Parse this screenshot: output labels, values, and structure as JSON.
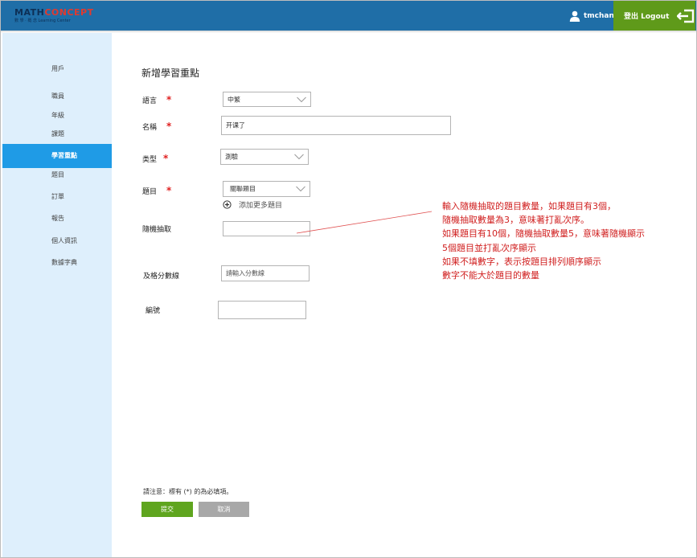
{
  "header": {
    "logo_line1_a": "MATH",
    "logo_line1_b": "CONCEPT",
    "logo_line2": "數 學 · 概 念  Learning Center",
    "username": "tmchan",
    "logout_label": "登出 Logout"
  },
  "sidebar": {
    "items": [
      {
        "label": "用戶"
      },
      {
        "label": "職員"
      },
      {
        "label": "年級"
      },
      {
        "label": "課題"
      },
      {
        "label": "學習重點"
      },
      {
        "label": "題目"
      },
      {
        "label": "訂單"
      },
      {
        "label": "報告"
      },
      {
        "label": "個人資訊"
      },
      {
        "label": "數據字典"
      }
    ],
    "active": "學習重點"
  },
  "form": {
    "title": "新增學習重點",
    "language_label": "語言",
    "language_value": "中繁",
    "name_label": "名稱",
    "name_value": "开课了",
    "type_label": "类型",
    "type_value": "測驗",
    "question_label": "題目",
    "question_value": "關聯題目",
    "add_more": "添加更多題目",
    "random_label": "隨機抽取",
    "random_value": "",
    "pass_label": "及格分數線",
    "pass_placeholder": "請輸入分數線",
    "code_label": "編號",
    "code_value": "",
    "required_mark": "*"
  },
  "note": {
    "lines": [
      "輸入隨機抽取的題目數量，如果題目有3個，",
      "隨機抽取數量為3，意味著打亂次序。",
      "如果題目有10個，隨機抽取數量5，意味著隨機顯示",
      "5個題目並打亂次序顯示",
      "如果不填數字，表示按題目排列順序顯示",
      "數字不能大於題目的數量"
    ]
  },
  "footer": {
    "required_note": "請注意：標有 (*) 的為必填項。",
    "submit_label": "提交",
    "cancel_label": "取消"
  },
  "colors": {
    "header_bg": "#1f6ea7",
    "logout_bg": "#5f9a1a",
    "sidebar_bg": "#deeffc",
    "sidebar_active": "#1f9be6",
    "required": "#e02020",
    "note_text": "#d02020",
    "submit_bg": "#5fa51f",
    "cancel_bg": "#a8a8a8"
  },
  "icons": {
    "user": "user-icon",
    "logout": "logout-icon",
    "dropdown": "chevron-down-icon",
    "add": "plus-circle-icon"
  }
}
